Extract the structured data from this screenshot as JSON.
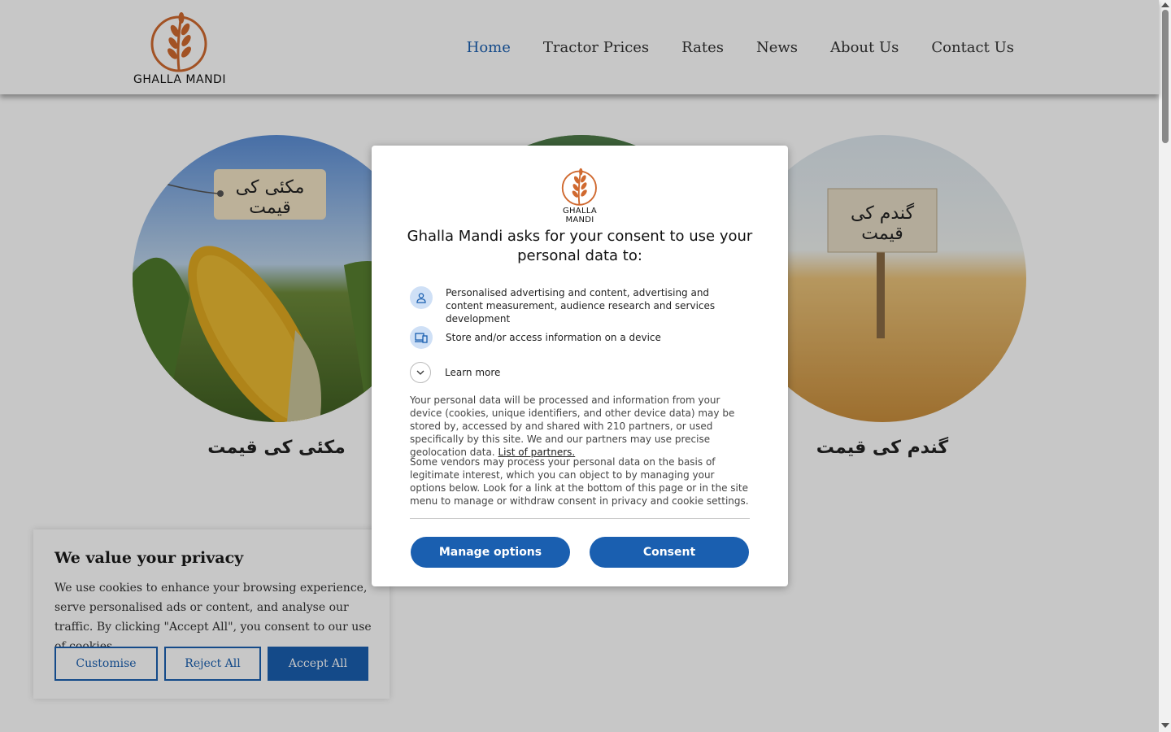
{
  "header": {
    "logo_text": "GHALLA MANDI",
    "nav": [
      {
        "label": "Home",
        "active": true
      },
      {
        "label": "Tractor Prices"
      },
      {
        "label": "Rates"
      },
      {
        "label": "News"
      },
      {
        "label": "About Us"
      },
      {
        "label": "Contact Us"
      }
    ]
  },
  "cards": [
    {
      "sign": "مکئی کی قیمت",
      "caption": "مکئی کی قیمت"
    },
    {
      "sign": "",
      "caption": ""
    },
    {
      "sign": "گندم کی قیمت",
      "caption": "گندم کی قیمت"
    }
  ],
  "cookie_banner": {
    "title": "We value your privacy",
    "text": "We use cookies to enhance your browsing experience, serve personalised ads or content, and analyse our traffic. By clicking \"Accept All\", you consent to our use of cookies.",
    "customise": "Customise",
    "reject": "Reject All",
    "accept": "Accept All"
  },
  "consent_modal": {
    "logo_text": "GHALLA MANDI",
    "title": "Ghalla Mandi asks for your consent to use your personal data to:",
    "purposes": [
      {
        "icon": "person-icon",
        "text": "Personalised advertising and content, advertising and content measurement, audience research and services development"
      },
      {
        "icon": "devices-icon",
        "text": "Store and/or access information on a device"
      }
    ],
    "learn_more": "Learn more",
    "para1": "Your personal data will be processed and information from your device (cookies, unique identifiers, and other device data) may be stored by, accessed by and shared with 210 partners, or used specifically by this site. We and our partners may use precise geolocation data.",
    "partners_link": "List of partners.",
    "para2": "Some vendors may process your personal data on the basis of legitimate interest, which you can object to by managing your options below. Look for a link at the bottom of this page or in the site menu to manage or withdraw consent in privacy and cookie settings.",
    "manage": "Manage options",
    "consent": "Consent"
  },
  "colors": {
    "brand_blue": "#1a5fb0",
    "logo_orange": "#d0692f"
  }
}
